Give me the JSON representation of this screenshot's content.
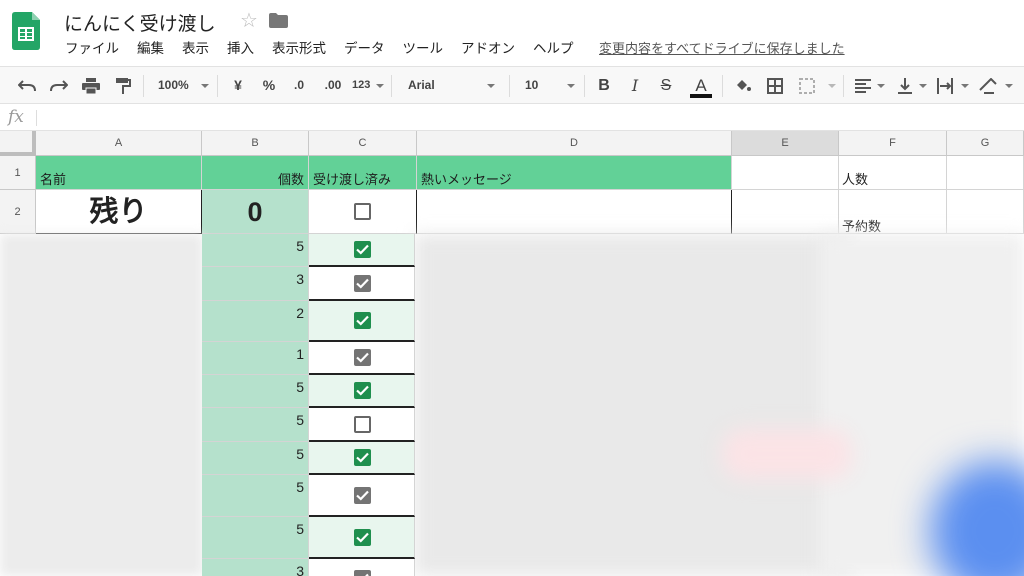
{
  "app": {
    "title": "にんにく受け渡し",
    "save_status": "変更内容をすべてドライブに保存しました"
  },
  "menu": [
    "ファイル",
    "編集",
    "表示",
    "挿入",
    "表示形式",
    "データ",
    "ツール",
    "アドオン",
    "ヘルプ"
  ],
  "toolbar": {
    "zoom": "100%",
    "currency": "¥",
    "percent": "%",
    "decrease_decimal": ".0",
    "increase_decimal": ".00",
    "more_formats": "123",
    "font": "Arial",
    "font_size": "10",
    "bold": "B",
    "italic": "I",
    "strike": "S",
    "text_color_letter": "A"
  },
  "formula_bar": {
    "fx": "fx"
  },
  "columns": [
    "A",
    "B",
    "C",
    "D",
    "E",
    "F",
    "G"
  ],
  "rows": [
    "1",
    "2"
  ],
  "header_row": {
    "name": "名前",
    "count": "個数",
    "handed_over": "受け渡し済み",
    "message": "熱いメッセージ",
    "people": "人数"
  },
  "row2": {
    "label": "残り",
    "remaining": "0",
    "reservations": "予約数"
  },
  "data_rows": [
    {
      "count": "5",
      "checked": true,
      "style": "green"
    },
    {
      "count": "3",
      "checked": true,
      "style": "gray"
    },
    {
      "count": "2",
      "checked": true,
      "style": "green"
    },
    {
      "count": "1",
      "checked": true,
      "style": "gray"
    },
    {
      "count": "5",
      "checked": true,
      "style": "green"
    },
    {
      "count": "5",
      "checked": false,
      "style": "empty"
    },
    {
      "count": "5",
      "checked": true,
      "style": "green"
    },
    {
      "count": "5",
      "checked": true,
      "style": "gray"
    },
    {
      "count": "5",
      "checked": true,
      "style": "green"
    },
    {
      "count": "3",
      "checked": true,
      "style": "gray"
    }
  ],
  "colors": {
    "header_green": "#62d197",
    "count_green": "#b5e1cc",
    "check_green": "#1f8f4e",
    "check_gray": "#747474"
  }
}
